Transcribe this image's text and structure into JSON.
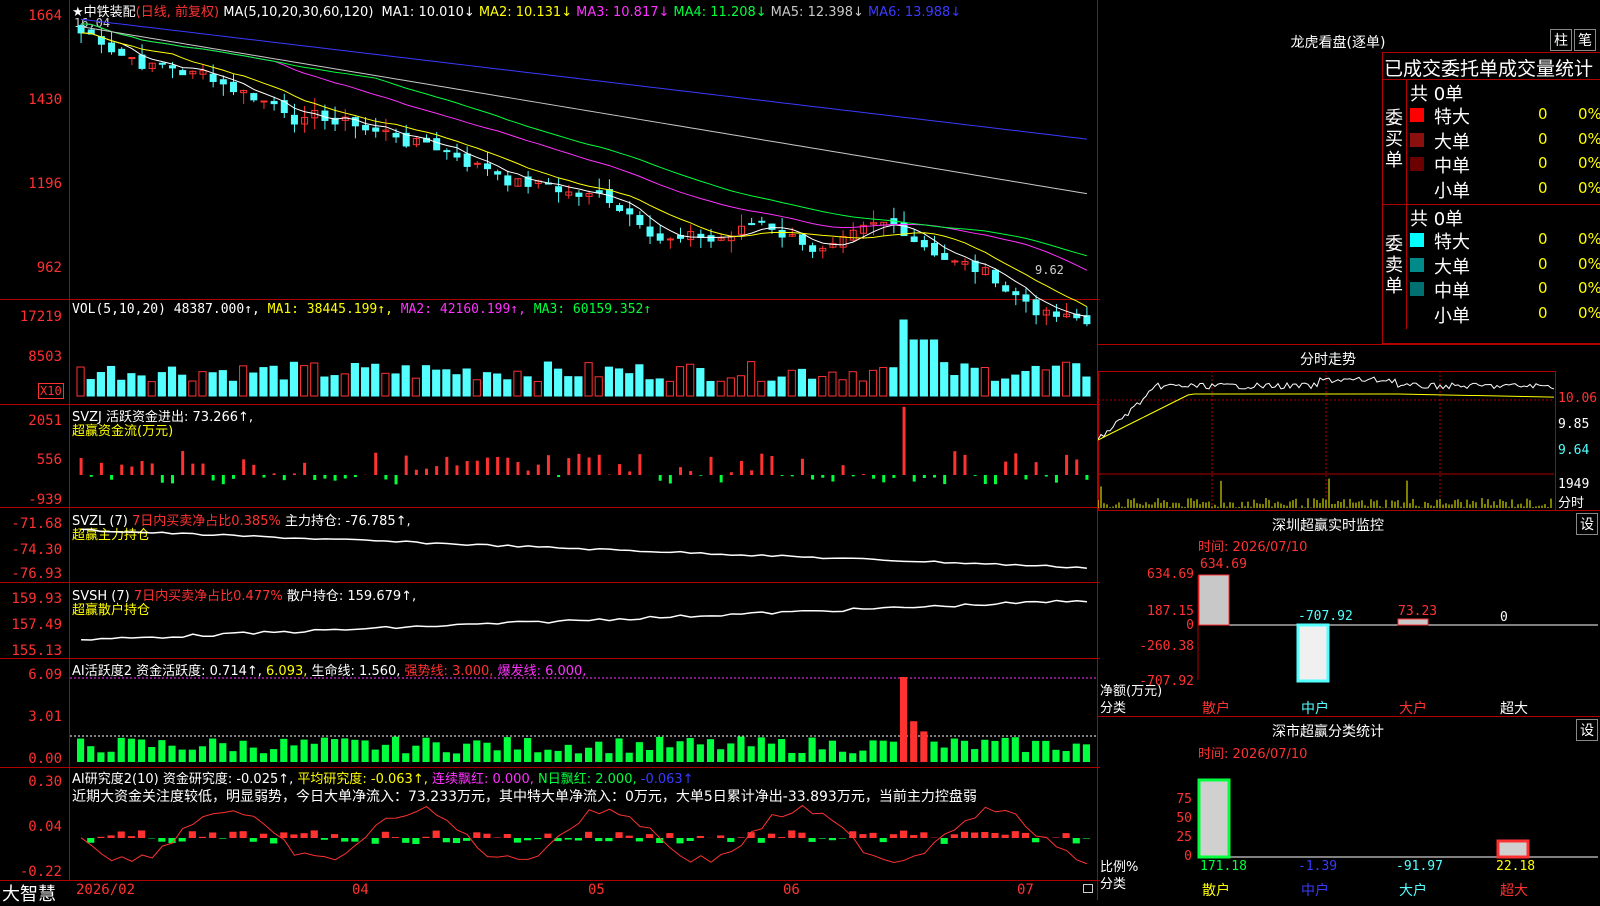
{
  "main": {
    "star": "★",
    "stock_name": "中铁装配",
    "mode": "(日线, 前复权)",
    "ma_label": "MA(5,10,20,30,60,120)",
    "ma_items": [
      {
        "name": "MA1:",
        "value": "10.010↓",
        "color": "#ffffff"
      },
      {
        "name": "MA2:",
        "value": "10.131↓",
        "color": "#ffff00"
      },
      {
        "name": "MA3:",
        "value": "10.817↓",
        "color": "#ff32ff"
      },
      {
        "name": "MA4:",
        "value": "11.208↓",
        "color": "#00ff3c"
      },
      {
        "name": "MA5:",
        "value": "12.398↓",
        "color": "#c8c8c8"
      },
      {
        "name": "MA6:",
        "value": "13.988↓",
        "color": "#3a3aff"
      }
    ],
    "high_label": "16.04",
    "low_label": "9.62",
    "y_ticks": [
      "1664",
      "1430",
      "1196",
      "962"
    ]
  },
  "vol": {
    "title": "VOL(5,10,20)",
    "value": "48387.000↑,",
    "ma1": "MA1: 38445.199↑,",
    "ma2": "MA2: 42160.199↑,",
    "ma3": "MA3: 60159.352↑",
    "y_ticks": [
      "17219",
      "8503"
    ],
    "unit": "X10"
  },
  "svzj": {
    "title": "SVZJ  活跃资金进出: 73.266↑,",
    "subtitle": "超赢资金流(万元)",
    "y_ticks": [
      "2051",
      "556",
      "-939"
    ]
  },
  "svzl": {
    "title": "SVZL (7)",
    "part2": "7日内买卖净占比0.385%",
    "part3": "主力持仓: -76.785↑,",
    "subtitle": "超赢主力持仓",
    "y_ticks": [
      "-71.68",
      "-74.30",
      "-76.93"
    ]
  },
  "svsh": {
    "title": "SVSH (7)",
    "part2": "7日内买卖净占比0.477%",
    "part3": "散户持仓: 159.679↑,",
    "subtitle": "超赢散户持仓",
    "y_ticks": [
      "159.93",
      "157.49",
      "155.13"
    ]
  },
  "ai1": {
    "title": "AI活跃度2 资金活跃度: 0.714↑,",
    "p2": "6.093,",
    "p3": "生命线: 1.560,",
    "p4": "强势线: 3.000,",
    "p5": "爆发线: 6.000,",
    "y_ticks": [
      "6.09",
      "3.01",
      "0.00"
    ]
  },
  "ai2": {
    "title": "AI研究度2(10) 资金研究度: -0.025↑,",
    "p2": "平均研究度: -0.063↑,",
    "p3": "连续飘红: 0.000,",
    "p4": "N日飘红: 2.000,",
    "p5": "-0.063↑",
    "note": "近期大资金关注度较低，明显弱势，今日大单净流入：73.233万元，其中特大单净流入：0万元，大单5日累计净出-33.893万元，当前主力控盘弱",
    "y_ticks": [
      "0.30",
      "0.04",
      "-0.22"
    ]
  },
  "bottom": {
    "app_name": "大智慧",
    "dates": [
      "2026/02",
      "04",
      "05",
      "06",
      "07"
    ]
  },
  "right": {
    "lhb_title": "龙虎看盘(逐单)",
    "btn_bar": "柱",
    "btn_pen": "笔",
    "table_header": "已成交委托单成交量统计",
    "buy_label": "委买单",
    "sell_label": "委卖单",
    "buy_total": "共 0单",
    "sell_total": "共 0单",
    "buy_rows": [
      {
        "name": "特大",
        "count": "0",
        "pct": "0%",
        "color": "#ff0000"
      },
      {
        "name": "大单",
        "count": "0",
        "pct": "0%",
        "color": "#8a1010"
      },
      {
        "name": "中单",
        "count": "0",
        "pct": "0%",
        "color": "#6a0000"
      },
      {
        "name": "小单",
        "count": "0",
        "pct": "0%",
        "color": "#000000"
      }
    ],
    "sell_rows": [
      {
        "name": "特大",
        "count": "0",
        "pct": "0%",
        "color": "#00ffff"
      },
      {
        "name": "大单",
        "count": "0",
        "pct": "0%",
        "color": "#008a8a"
      },
      {
        "name": "中单",
        "count": "0",
        "pct": "0%",
        "color": "#007070"
      },
      {
        "name": "小单",
        "count": "0",
        "pct": "0%",
        "color": "#000000"
      }
    ],
    "intraday_title": "分时走势",
    "intraday_ticks": [
      "10.06",
      "9.85",
      "9.64",
      "1949"
    ],
    "intraday_unit": "分时",
    "monitor_title": "深圳超赢实时监控",
    "monitor_btn": "设",
    "monitor_time": "时间: 2026/07/10",
    "monitor_ticks": [
      "634.69",
      "187.15",
      "0",
      "-260.38",
      "-707.92"
    ],
    "monitor_values": [
      "634.69",
      "-707.92",
      "73.23",
      "0"
    ],
    "monitor_ylabel": "净额(万元)",
    "monitor_xlabel": "分类",
    "monitor_cats": [
      "散户",
      "中户",
      "大户",
      "超大"
    ],
    "stats_title": "深市超赢分类统计",
    "stats_btn": "设",
    "stats_time": "时间: 2026/07/10",
    "stats_ticks": [
      "75",
      "50",
      "25",
      "0"
    ],
    "stats_values": [
      "171.18",
      "-1.39",
      "-91.97",
      "22.18"
    ],
    "stats_ylabel": "比例%",
    "stats_xlabel": "分类",
    "stats_cats": [
      "散户",
      "中户",
      "大户",
      "超大"
    ]
  }
}
